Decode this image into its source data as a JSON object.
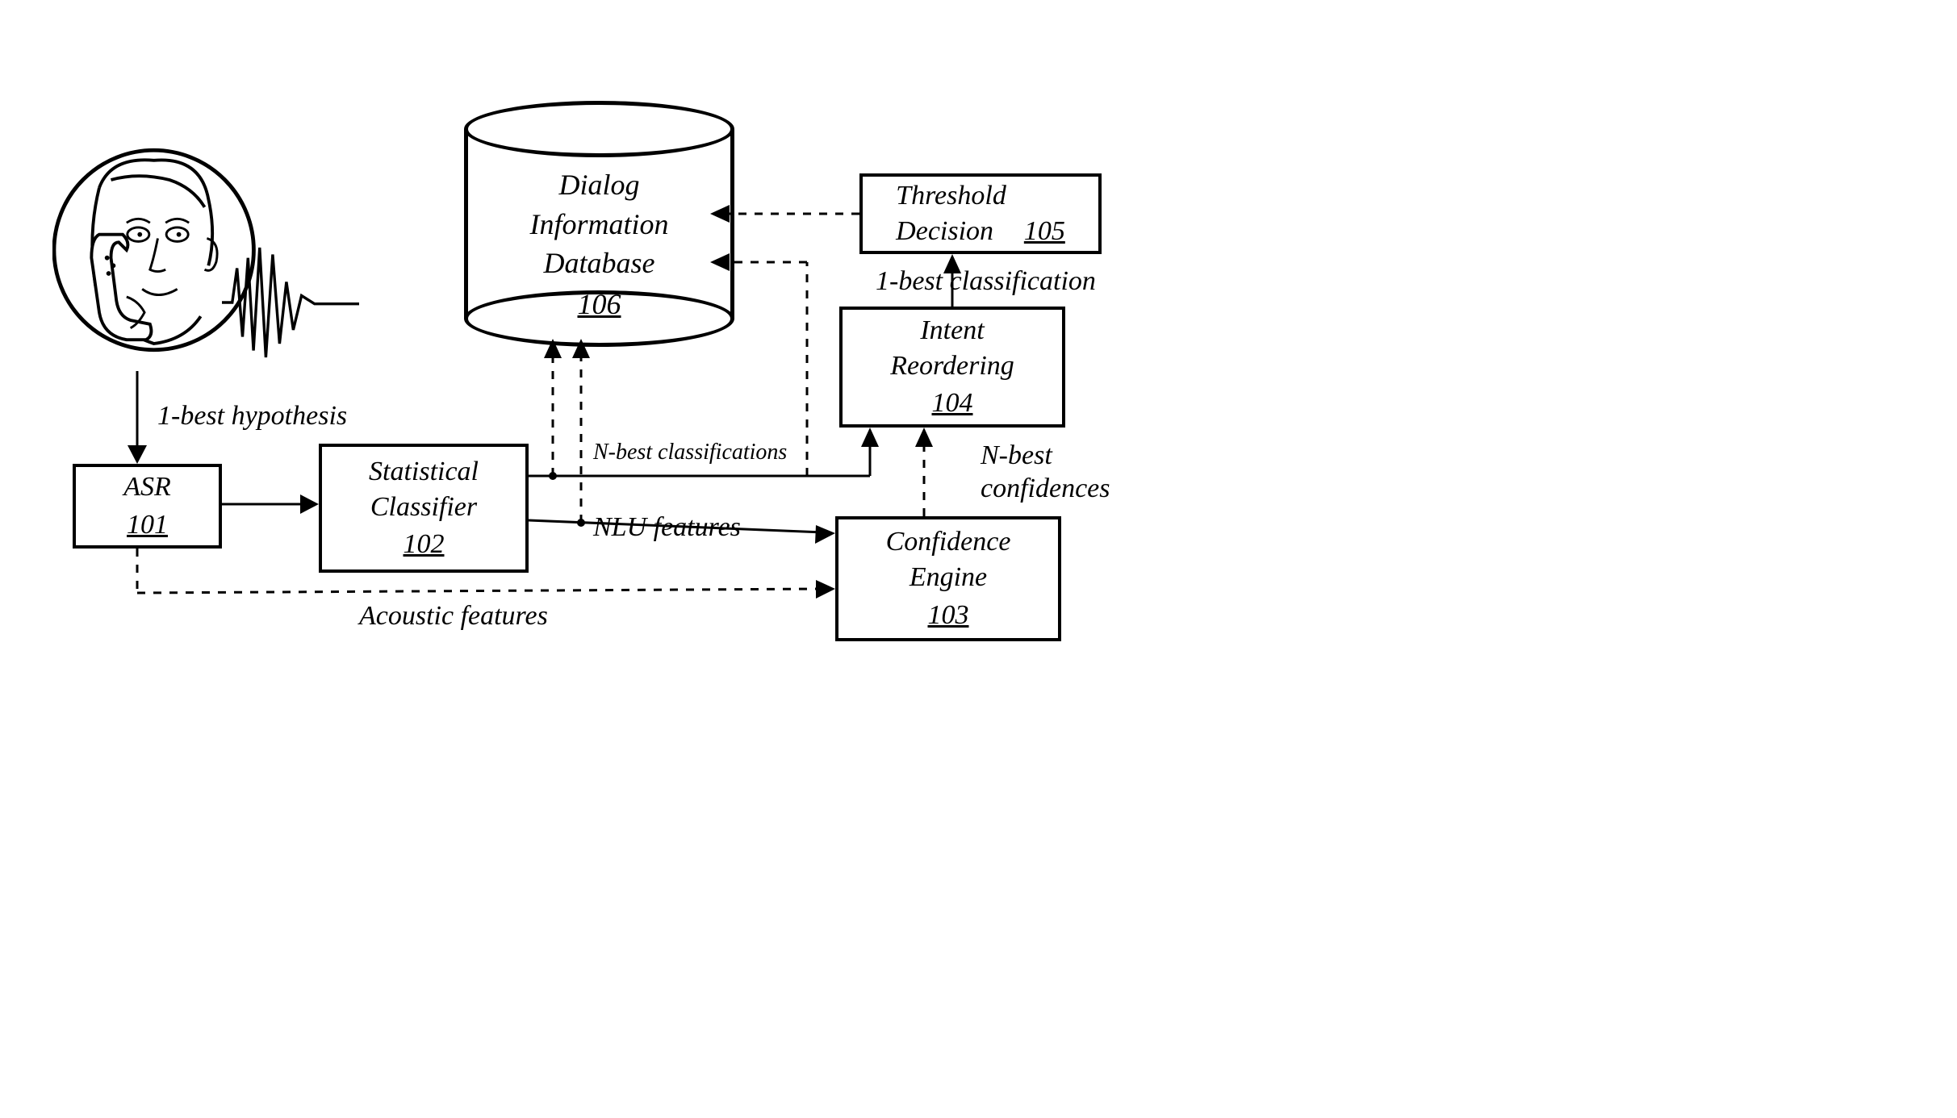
{
  "nodes": {
    "user": {
      "alt": "user-on-phone-icon"
    },
    "asr": {
      "label": "ASR",
      "ref": "101"
    },
    "classifier": {
      "label1": "Statistical",
      "label2": "Classifier",
      "ref": "102"
    },
    "db": {
      "label1": "Dialog",
      "label2": "Information",
      "label3": "Database",
      "ref": "106"
    },
    "confidence": {
      "label1": "Confidence",
      "label2": "Engine",
      "ref": "103"
    },
    "reorder": {
      "label1": "Intent",
      "label2": "Reordering",
      "ref": "104"
    },
    "threshold": {
      "label1": "Threshold",
      "label2": "Decision",
      "ref": "105"
    }
  },
  "edges": {
    "hypothesis": "1-best hypothesis",
    "acoustic": "Acoustic features",
    "nlu": "NLU features",
    "nbest_class": "N-best classifications",
    "nbest_conf": "N-best\nconfidences",
    "onebest_class": "1-best classification"
  }
}
